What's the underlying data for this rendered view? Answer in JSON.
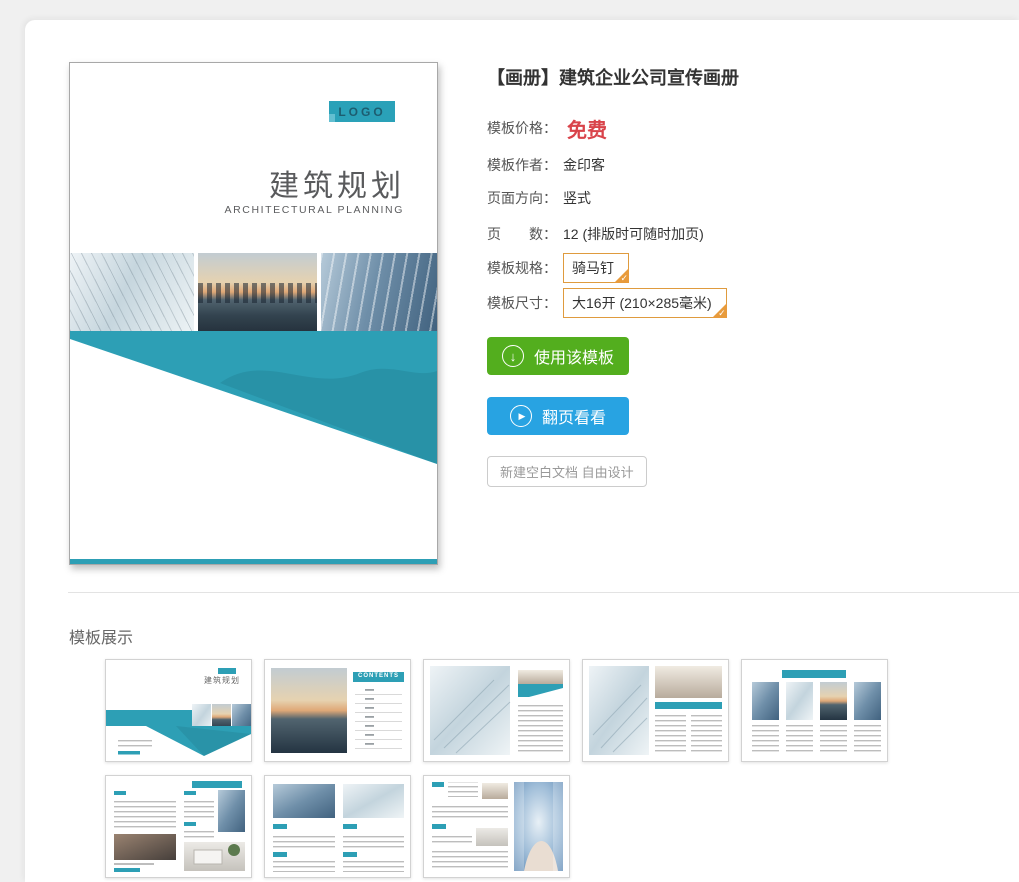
{
  "colors": {
    "teal": "#2d9fb5",
    "green": "#53ae1e",
    "blue": "#28a3e2",
    "red": "#d9434a",
    "orange": "#df9b3e"
  },
  "preview": {
    "logo_text": "LOGO",
    "cover_title": "建筑规划",
    "cover_subtitle": "ARCHITECTURAL PLANNING"
  },
  "details": {
    "title": "【画册】建筑企业公司宣传画册",
    "price": {
      "label": "模板价格：",
      "value": "免费"
    },
    "author": {
      "label": "模板作者：",
      "value": "金印客"
    },
    "orientation": {
      "label": "页面方向：",
      "value": "竖式"
    },
    "pages": {
      "label": "页　　数：",
      "value": "12 (排版时可随时加页)"
    },
    "spec": {
      "label": "模板规格：",
      "value": "骑马钉"
    },
    "size": {
      "label": "模板尺寸：",
      "value": "大16开 (210×285毫米)"
    }
  },
  "actions": {
    "use_template": "使用该模板",
    "flip_preview": "翻页看看",
    "new_blank": "新建空白文档 自由设计"
  },
  "icons": {
    "download": "↓",
    "play": "▶",
    "check": "✓"
  },
  "showcase": {
    "heading": "模板展示",
    "cover_title": "建筑规划",
    "contents_label": "CONTENTS",
    "thumbnails": [
      "cover-spread",
      "city-contents-spread",
      "building-text-spread",
      "glass-interior-spread",
      "four-column-spread",
      "two-column-photos-spread",
      "dual-photo-text-spread",
      "curved-building-spread"
    ]
  }
}
